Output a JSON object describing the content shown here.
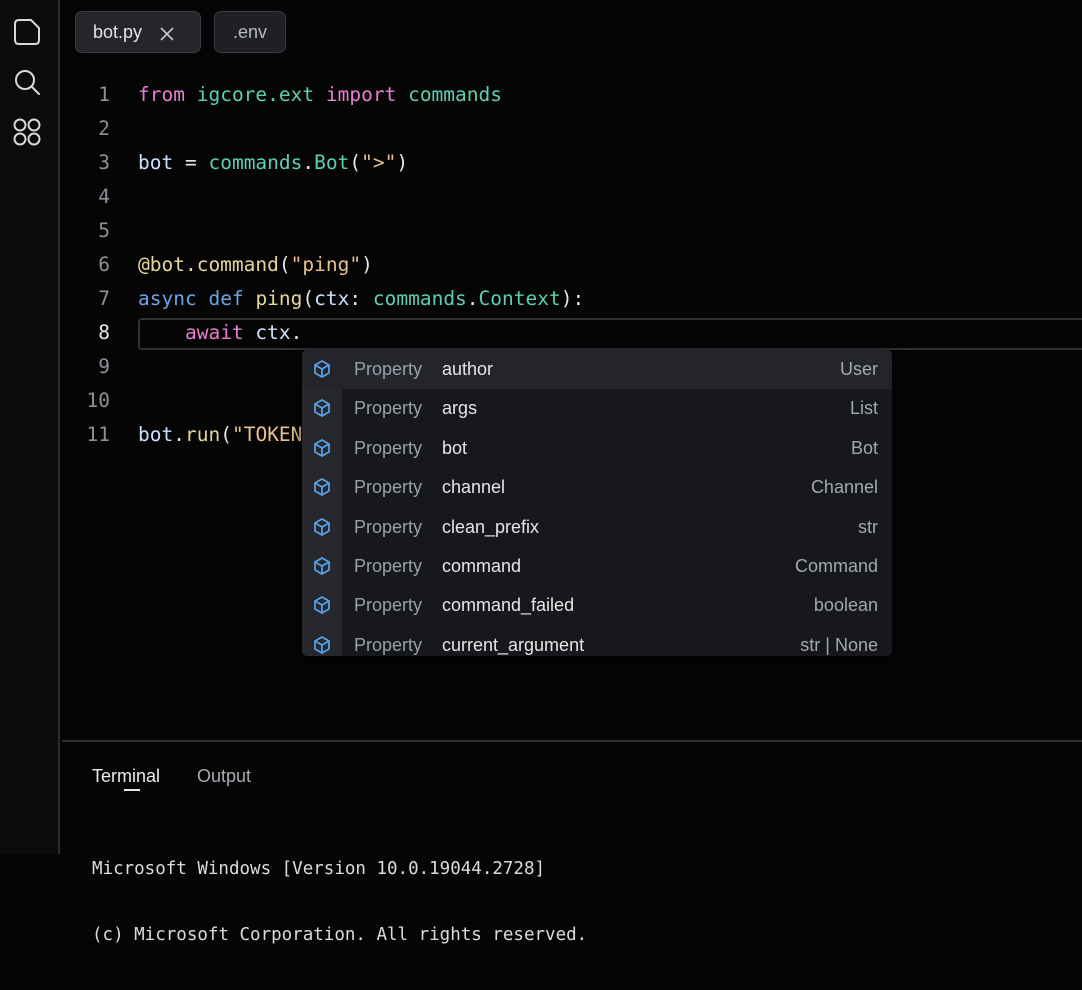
{
  "activity_bar": {
    "icons": [
      "files-icon",
      "search-icon",
      "extensions-icon"
    ]
  },
  "tabs": [
    {
      "label": "bot.py",
      "active": true,
      "closable": true
    },
    {
      "label": ".env",
      "active": false
    }
  ],
  "editor": {
    "active_line": 8,
    "lines": [
      {
        "num": "1",
        "tokens": [
          {
            "t": "from",
            "c": "kw-pink"
          },
          {
            "t": " ",
            "c": "plain"
          },
          {
            "t": "igcore.ext",
            "c": "cls"
          },
          {
            "t": " ",
            "c": "plain"
          },
          {
            "t": "import",
            "c": "kw-pink"
          },
          {
            "t": " ",
            "c": "plain"
          },
          {
            "t": "commands",
            "c": "cls"
          }
        ]
      },
      {
        "num": "2",
        "tokens": []
      },
      {
        "num": "3",
        "tokens": [
          {
            "t": "bot",
            "c": "var"
          },
          {
            "t": " = ",
            "c": "plain"
          },
          {
            "t": "commands",
            "c": "cls"
          },
          {
            "t": ".",
            "c": "plain"
          },
          {
            "t": "Bot",
            "c": "cls"
          },
          {
            "t": "(",
            "c": "plain"
          },
          {
            "t": "\">\"",
            "c": "str"
          },
          {
            "t": ")",
            "c": "plain"
          }
        ]
      },
      {
        "num": "4",
        "tokens": []
      },
      {
        "num": "5",
        "tokens": []
      },
      {
        "num": "6",
        "tokens": [
          {
            "t": "@bot.command",
            "c": "fn"
          },
          {
            "t": "(",
            "c": "plain"
          },
          {
            "t": "\"ping\"",
            "c": "str"
          },
          {
            "t": ")",
            "c": "plain"
          }
        ]
      },
      {
        "num": "7",
        "tokens": [
          {
            "t": "async",
            "c": "kw-blue"
          },
          {
            "t": " ",
            "c": "plain"
          },
          {
            "t": "def",
            "c": "kw-blue"
          },
          {
            "t": " ",
            "c": "plain"
          },
          {
            "t": "ping",
            "c": "fn"
          },
          {
            "t": "(",
            "c": "plain"
          },
          {
            "t": "ctx",
            "c": "var"
          },
          {
            "t": ": ",
            "c": "plain"
          },
          {
            "t": "commands",
            "c": "cls"
          },
          {
            "t": ".",
            "c": "plain"
          },
          {
            "t": "Context",
            "c": "cls"
          },
          {
            "t": "):",
            "c": "plain"
          }
        ]
      },
      {
        "num": "8",
        "tokens": [
          {
            "t": "    ",
            "c": "plain"
          },
          {
            "t": "await",
            "c": "kw-pink"
          },
          {
            "t": " ",
            "c": "plain"
          },
          {
            "t": "ctx",
            "c": "var"
          },
          {
            "t": ".",
            "c": "plain"
          }
        ]
      },
      {
        "num": "9",
        "tokens": []
      },
      {
        "num": "10",
        "tokens": []
      },
      {
        "num": "11",
        "tokens": [
          {
            "t": "bot",
            "c": "var"
          },
          {
            "t": ".",
            "c": "plain"
          },
          {
            "t": "run",
            "c": "fn"
          },
          {
            "t": "(",
            "c": "plain"
          },
          {
            "t": "\"TOKEN",
            "c": "str"
          }
        ]
      }
    ]
  },
  "suggestions": [
    {
      "kind": "Property",
      "name": "author",
      "type": "User",
      "selected": true
    },
    {
      "kind": "Property",
      "name": "args",
      "type": "List"
    },
    {
      "kind": "Property",
      "name": "bot",
      "type": "Bot"
    },
    {
      "kind": "Property",
      "name": "channel",
      "type": "Channel"
    },
    {
      "kind": "Property",
      "name": "clean_prefix",
      "type": "str"
    },
    {
      "kind": "Property",
      "name": "command",
      "type": "Command"
    },
    {
      "kind": "Property",
      "name": "command_failed",
      "type": "boolean"
    },
    {
      "kind": "Property",
      "name": "current_argument",
      "type": "str | None"
    }
  ],
  "panel": {
    "tabs": [
      "Terminal",
      "Output"
    ],
    "active_tab": "Terminal",
    "terminal_lines": [
      "Microsoft Windows [Version 10.0.19044.2728]",
      "(c) Microsoft Corporation. All rights reserved."
    ]
  }
}
